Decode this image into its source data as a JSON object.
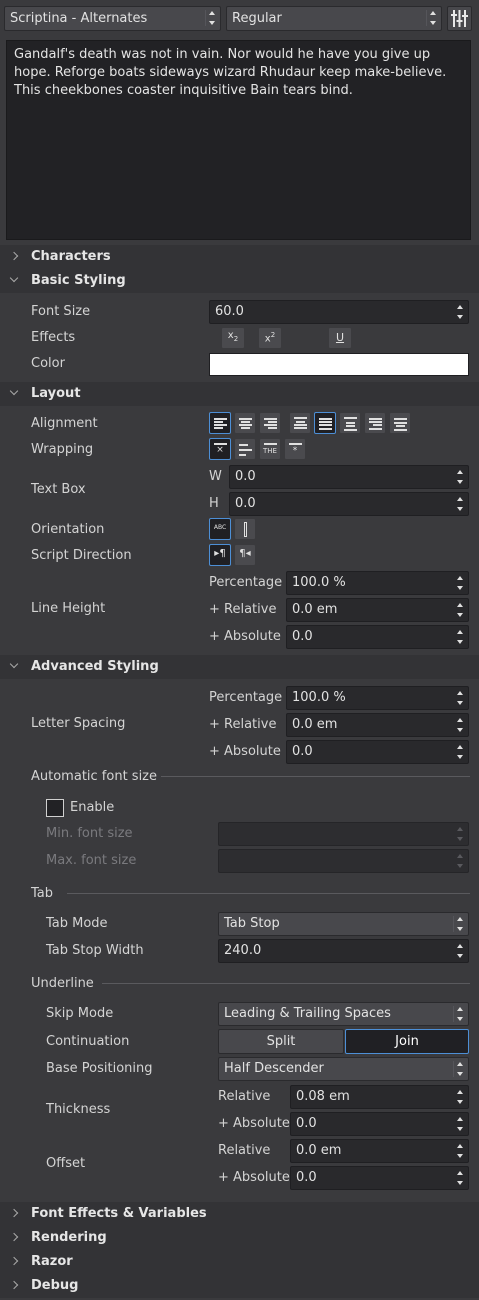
{
  "font_family": "Scriptina - Alternates",
  "font_style": "Regular",
  "preview_text": "Gandalf's death was not in vain. Nor would he have you give up hope. Reforge boats sideways wizard Rhudaur keep make-believe. This cheekbones coaster inquisitive Bain tears bind.",
  "sections": {
    "characters": "Characters",
    "basic_styling": "Basic Styling",
    "layout": "Layout",
    "advanced_styling": "Advanced Styling",
    "font_effects": "Font Effects & Variables",
    "rendering": "Rendering",
    "razor": "Razor",
    "debug": "Debug"
  },
  "basic": {
    "font_size_label": "Font Size",
    "font_size": "60.0",
    "effects_label": "Effects",
    "subscript": "x",
    "subscript_mark": "2",
    "superscript": "x",
    "superscript_mark": "2",
    "underline": "U",
    "color_label": "Color",
    "color_value": "#ffffff"
  },
  "layout": {
    "alignment_label": "Alignment",
    "wrapping_label": "Wrapping",
    "wrap_glyph_x": "×",
    "wrap_glyph_the": "THE",
    "wrap_glyph_star": "*",
    "textbox_label": "Text Box",
    "w_label": "W",
    "w_value": "0.0",
    "h_label": "H",
    "h_value": "0.0",
    "orientation_label": "Orientation",
    "orientation_glyph": "ABC",
    "script_direction_label": "Script Direction",
    "ltr_glyph": "▸¶",
    "rtl_glyph": "¶◂",
    "line_height_label": "Line Height",
    "lh_percentage_label": "Percentage",
    "lh_percentage": "100.0 %",
    "lh_relative_label": "+ Relative",
    "lh_relative": "0.0 em",
    "lh_absolute_label": "+ Absolute",
    "lh_absolute": "0.0"
  },
  "advanced": {
    "letter_spacing_label": "Letter Spacing",
    "ls_percentage_label": "Percentage",
    "ls_percentage": "100.0 %",
    "ls_relative_label": "+ Relative",
    "ls_relative": "0.0 em",
    "ls_absolute_label": "+ Absolute",
    "ls_absolute": "0.0",
    "auto_font_size_label": "Automatic font size",
    "enable_label": "Enable",
    "enable_checked": false,
    "min_font_label": "Min. font size",
    "max_font_label": "Max. font size",
    "tab_label": "Tab",
    "tab_mode_label": "Tab Mode",
    "tab_mode": "Tab Stop",
    "tab_stop_width_label": "Tab Stop Width",
    "tab_stop_width": "240.0",
    "underline_label": "Underline",
    "skip_mode_label": "Skip Mode",
    "skip_mode": "Leading & Trailing Spaces",
    "continuation_label": "Continuation",
    "split_label": "Split",
    "join_label": "Join",
    "continuation_selected": "Join",
    "base_positioning_label": "Base Positioning",
    "base_positioning": "Half Descender",
    "thickness_label": "Thickness",
    "th_relative_label": "Relative",
    "th_relative": "0.08 em",
    "th_absolute_label": "+ Absolute",
    "th_absolute": "0.0",
    "offset_label": "Offset",
    "of_relative_label": "Relative",
    "of_relative": "0.0 em",
    "of_absolute_label": "+ Absolute",
    "of_absolute": "0.0"
  },
  "colors": {
    "accent": "#4d8fd6",
    "panel": "#3a3a3d",
    "field": "#29292c",
    "header": "#333336"
  }
}
